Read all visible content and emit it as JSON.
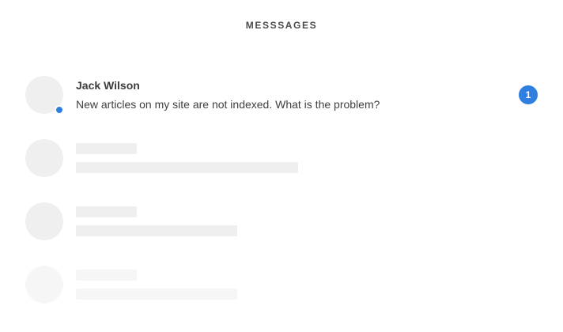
{
  "header": {
    "title": "MESSSAGES"
  },
  "conversations": [
    {
      "sender": "Jack Wilson",
      "preview": "New articles on my site are not indexed. What is the problem?",
      "unread_count": "1",
      "online": true
    }
  ],
  "placeholder_rows": 3,
  "colors": {
    "accent": "#2f7fe0",
    "skeleton": "#efefef",
    "text": "#3f3f3f"
  }
}
